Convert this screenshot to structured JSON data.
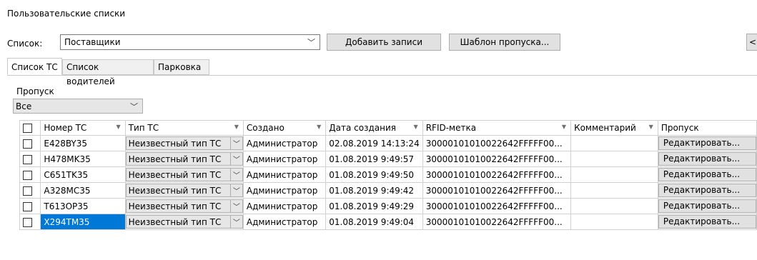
{
  "section_title": "Пользовательские списки",
  "list": {
    "label": "Список:",
    "value": "Поставщики",
    "arrow": "﹀"
  },
  "buttons": {
    "add_records": "Добавить записи",
    "pass_template": "Шаблон пропуска...",
    "edge": "<"
  },
  "tabs": [
    "Список ТС",
    "Список водителей",
    "Парковка"
  ],
  "pass_filter": {
    "label": "Пропуск",
    "value": "Все",
    "arrow": "﹀"
  },
  "table": {
    "columns": [
      "Номер ТС",
      "Тип ТС",
      "Создано",
      "Дата создания",
      "RFID-метка",
      "Комментарий",
      "Пропуск"
    ],
    "rows": [
      {
        "number": "E428BY35",
        "type": "Неизвестный тип ТС",
        "created_by": "Администратор",
        "date": "02.08.2019 14:13:24",
        "rfid": "30000101010022642FFFFF00...",
        "comment": "",
        "pass": "Редактировать..."
      },
      {
        "number": "H478MK35",
        "type": "Неизвестный тип ТС",
        "created_by": "Администратор",
        "date": "01.08.2019 9:49:57",
        "rfid": "30000101010022642FFFFF00...",
        "comment": "",
        "pass": "Редактировать..."
      },
      {
        "number": "C651TK35",
        "type": "Неизвестный тип ТС",
        "created_by": "Администратор",
        "date": "01.08.2019 9:49:50",
        "rfid": "30000101010022642FFFFF00...",
        "comment": "",
        "pass": "Редактировать..."
      },
      {
        "number": "A328MC35",
        "type": "Неизвестный тип ТС",
        "created_by": "Администратор",
        "date": "01.08.2019 9:49:42",
        "rfid": "30000101010022642FFFFF00...",
        "comment": "",
        "pass": "Редактировать..."
      },
      {
        "number": "T613OP35",
        "type": "Неизвестный тип ТС",
        "created_by": "Администратор",
        "date": "01.08.2019 9:49:29",
        "rfid": "30000101010022642FFFFF00...",
        "comment": "",
        "pass": "Редактировать..."
      },
      {
        "number": "X294TM35",
        "type": "Неизвестный тип ТС",
        "created_by": "Администратор",
        "date": "01.08.2019 9:49:04",
        "rfid": "30000101010022642FFFFF00...",
        "comment": "",
        "pass": "Редактировать..."
      }
    ],
    "selected_row": 5,
    "type_arrow": "﹀"
  },
  "colors": {
    "selection": "#0078d7",
    "border": "#d0d0d0",
    "button": "#e1e1e1"
  }
}
